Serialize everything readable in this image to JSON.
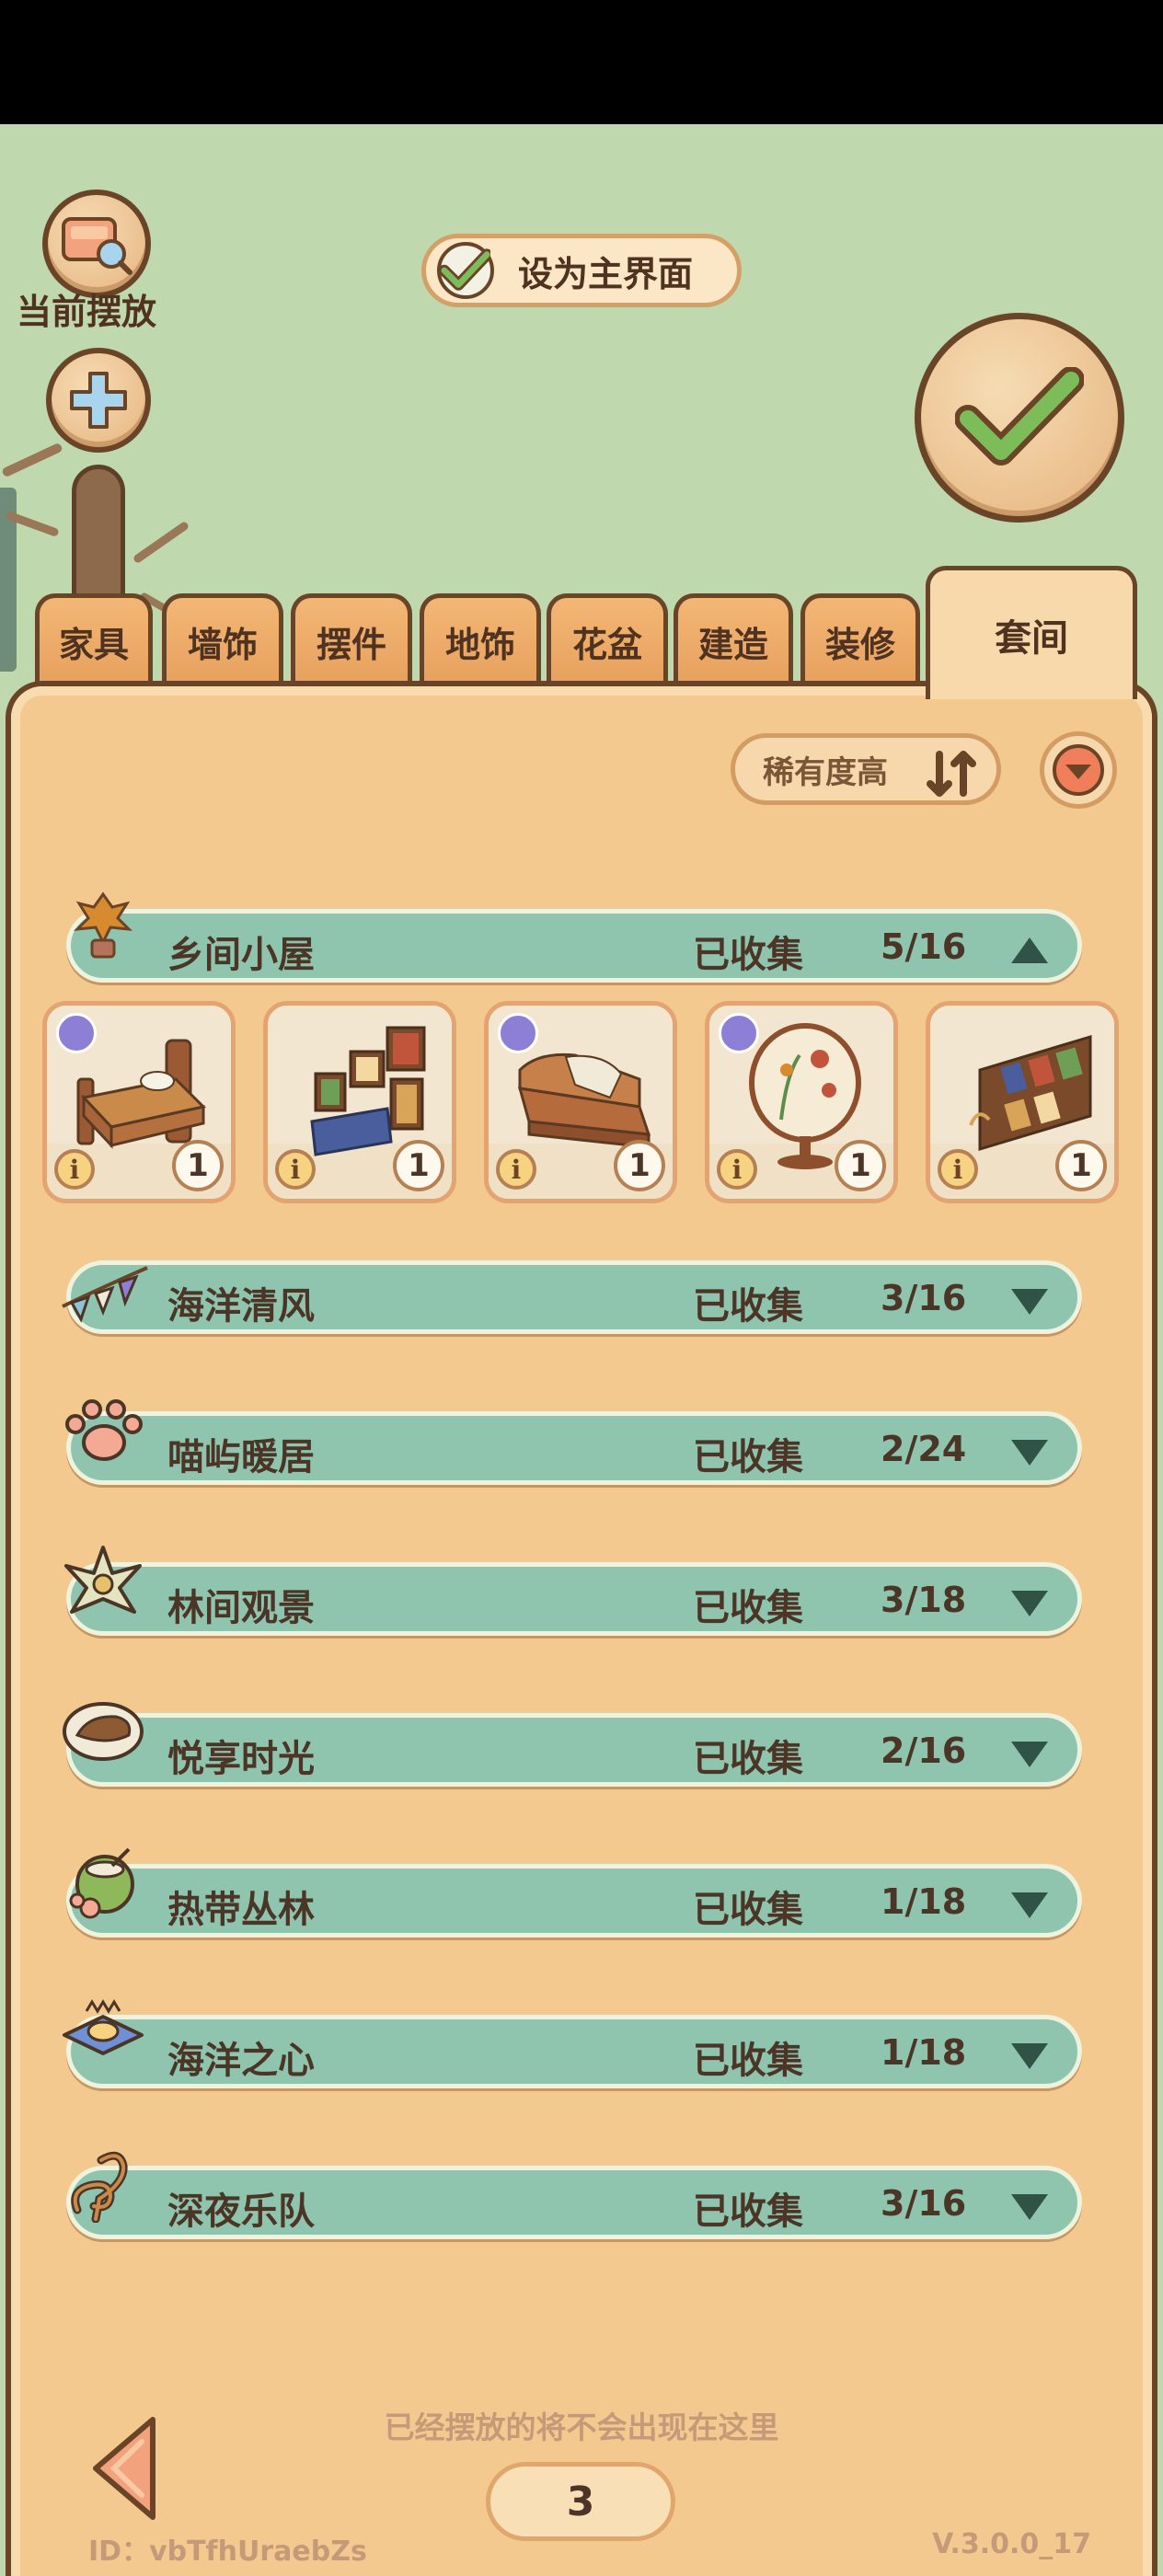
{
  "toolbar": {
    "current_placed_label": "当前摆放",
    "set_main_label": "设为主界面",
    "set_main_checked": true
  },
  "tabs": [
    {
      "label": "家具",
      "active": false
    },
    {
      "label": "墙饰",
      "active": false
    },
    {
      "label": "摆件",
      "active": false
    },
    {
      "label": "地饰",
      "active": false
    },
    {
      "label": "花盆",
      "active": false
    },
    {
      "label": "建造",
      "active": false
    },
    {
      "label": "装修",
      "active": false
    },
    {
      "label": "套间",
      "active": true
    }
  ],
  "sort": {
    "label": "稀有度高"
  },
  "sets": [
    {
      "name": "乡间小屋",
      "collected_label": "已收集",
      "count": "5/16",
      "expanded": true,
      "icon": "autumn-plant-icon"
    },
    {
      "name": "海洋清风",
      "collected_label": "已收集",
      "count": "3/16",
      "expanded": false,
      "icon": "bunting-flag-icon"
    },
    {
      "name": "喵屿暖居",
      "collected_label": "已收集",
      "count": "2/24",
      "expanded": false,
      "icon": "paw-print-icon"
    },
    {
      "name": "林间观景",
      "collected_label": "已收集",
      "count": "3/18",
      "expanded": false,
      "icon": "leaf-flower-icon"
    },
    {
      "name": "悦享时光",
      "collected_label": "已收集",
      "count": "2/16",
      "expanded": false,
      "icon": "bread-plate-icon"
    },
    {
      "name": "热带丛林",
      "collected_label": "已收集",
      "count": "1/18",
      "expanded": false,
      "icon": "coconut-drink-icon"
    },
    {
      "name": "海洋之心",
      "collected_label": "已收集",
      "count": "1/18",
      "expanded": false,
      "icon": "shell-cushion-icon"
    },
    {
      "name": "深夜乐队",
      "collected_label": "已收集",
      "count": "3/16",
      "expanded": false,
      "icon": "treble-clef-icon"
    }
  ],
  "items": [
    {
      "icon": "wooden-bed-icon",
      "qty": "1"
    },
    {
      "icon": "picture-frames-icon",
      "qty": "1"
    },
    {
      "icon": "sofa-icon",
      "qty": "1"
    },
    {
      "icon": "floral-lamp-icon",
      "qty": "1"
    },
    {
      "icon": "magazine-rack-icon",
      "qty": "1"
    }
  ],
  "footer": {
    "hint": "已经摆放的将不会出现在这里",
    "page": "3",
    "user_id": "ID：vbTfhUraebZs",
    "version": "V.3.0.0_17"
  },
  "colors": {
    "background": "#bfd8ae",
    "panel": "#f4c98f",
    "set_row": "#8fc4af",
    "outline": "#6a4427",
    "check_green": "#7cbd5a"
  }
}
